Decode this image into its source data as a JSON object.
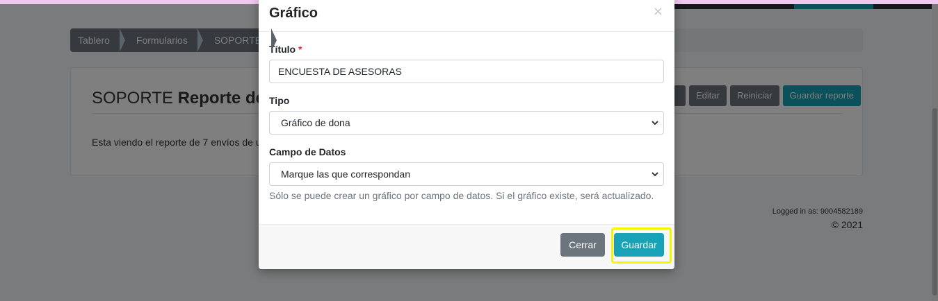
{
  "breadcrumb": [
    "Tablero",
    "Formularios",
    "SOPORTE"
  ],
  "card": {
    "title_prefix": "SOPORTE",
    "title_bold": "Reporte de",
    "text": "Esta viendo el reporte de 7 envíos de u",
    "buttons": {
      "edit": "Editar",
      "reset": "Reiniciar",
      "save_report": "Guardar reporte"
    }
  },
  "footer": {
    "logged_in": "Logged in as: 9004582189",
    "copyright": "© 2021"
  },
  "modal": {
    "title": "Gráfico",
    "close_symbol": "×",
    "fields": {
      "title_label": "Título",
      "required_mark": "*",
      "title_value": "ENCUESTA DE ASESORAS",
      "type_label": "Tipo",
      "type_value": "Gráfico de dona",
      "data_field_label": "Campo de Datos",
      "data_field_value": "Marque las que correspondan"
    },
    "help_text": "Sólo se puede crear un gráfico por campo de datos. Si el gráfico existe, será actualizado.",
    "buttons": {
      "close": "Cerrar",
      "save": "Guardar"
    }
  },
  "icons": [
    "close-icon",
    "chevron-down-icon"
  ],
  "colors": {
    "primary": "#17a2b8",
    "secondary": "#6c757d",
    "highlight": "#f5f500",
    "required": "#dc3545"
  }
}
